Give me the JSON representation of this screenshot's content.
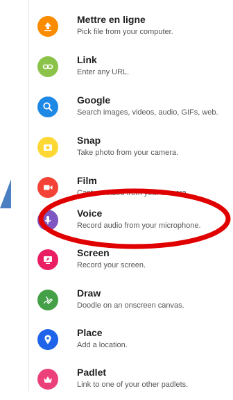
{
  "menu": {
    "items": [
      {
        "title": "Mettre en ligne",
        "subtitle": "Pick file from your computer.",
        "color": "#fb8c00",
        "icon": "upload-icon"
      },
      {
        "title": "Link",
        "subtitle": "Enter any URL.",
        "color": "#8bc34a",
        "icon": "link-icon"
      },
      {
        "title": "Google",
        "subtitle": "Search images, videos, audio, GIFs, web.",
        "color": "#1e88e5",
        "icon": "search-icon"
      },
      {
        "title": "Snap",
        "subtitle": "Take photo from your camera.",
        "color": "#fdd835",
        "icon": "camera-icon"
      },
      {
        "title": "Film",
        "subtitle": "Capture video from your camera.",
        "color": "#f44336",
        "icon": "video-icon"
      },
      {
        "title": "Voice",
        "subtitle": "Record audio from your microphone.",
        "color": "#7e57c2",
        "icon": "microphone-icon"
      },
      {
        "title": "Screen",
        "subtitle": "Record your screen.",
        "color": "#e91e63",
        "icon": "screen-record-icon"
      },
      {
        "title": "Draw",
        "subtitle": "Doodle on an onscreen canvas.",
        "color": "#43a047",
        "icon": "draw-icon"
      },
      {
        "title": "Place",
        "subtitle": "Add a location.",
        "color": "#1e63e9",
        "icon": "location-pin-icon"
      },
      {
        "title": "Padlet",
        "subtitle": "Link to one of your other padlets.",
        "color": "#ec407a",
        "icon": "padlet-icon"
      }
    ]
  },
  "annotation": {
    "color": "#e00000",
    "highlighted_item": "Voice"
  },
  "accent_arrow_color": "#4a7fc1"
}
